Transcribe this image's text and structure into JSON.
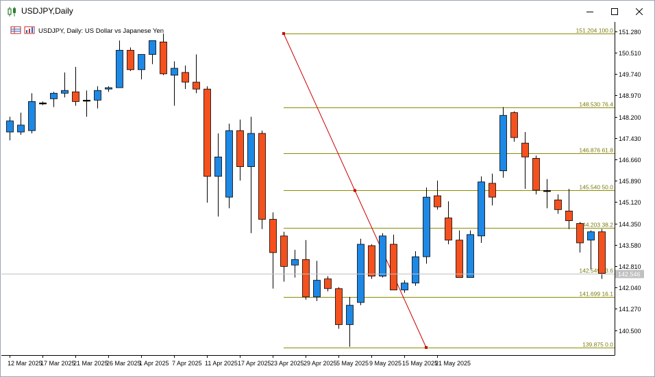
{
  "window": {
    "title": "USDJPY,Daily",
    "icons": [
      "candlestick-chart-icon",
      "minimize-icon",
      "maximize-icon",
      "close-icon"
    ]
  },
  "chart_header": {
    "text": "USDJPY, Daily:  US Dollar vs Japanese Yen",
    "icons": [
      "table-icon",
      "indicator-icon"
    ]
  },
  "chart_data": {
    "type": "candlestick",
    "symbol": "USDJPY",
    "timeframe": "Daily",
    "ylim": [
      139.6,
      151.55
    ],
    "y_ticks": [
      "151.280",
      "150.510",
      "149.740",
      "148.970",
      "148.200",
      "147.430",
      "146.660",
      "145.890",
      "145.120",
      "144.350",
      "143.580",
      "142.810",
      "142.040",
      "141.270",
      "140.500"
    ],
    "x_ticks": [
      "12 Mar 2025",
      "17 Mar 2025",
      "21 Mar 2025",
      "26 Mar 2025",
      "1 Apr 2025",
      "7 Apr 2025",
      "11 Apr 2025",
      "17 Apr 2025",
      "23 Apr 2025",
      "29 Apr 2025",
      "5 May 2025",
      "9 May 2025",
      "15 May 2025",
      "21 May 2025"
    ],
    "x_tick_index": [
      0,
      3,
      6,
      9,
      12,
      15,
      18,
      21,
      24,
      27,
      30,
      33,
      36,
      39
    ],
    "up_color": "#1e88e5",
    "down_color": "#f4511e",
    "current_price": "142.546",
    "candles": [
      {
        "o": 147.65,
        "h": 148.2,
        "l": 147.35,
        "c": 148.05
      },
      {
        "o": 147.65,
        "h": 148.35,
        "l": 147.55,
        "c": 147.9
      },
      {
        "o": 147.7,
        "h": 149.05,
        "l": 147.6,
        "c": 148.75
      },
      {
        "o": 148.7,
        "h": 148.75,
        "l": 148.62,
        "c": 148.7
      },
      {
        "o": 148.85,
        "h": 149.1,
        "l": 148.55,
        "c": 149.05
      },
      {
        "o": 149.05,
        "h": 149.8,
        "l": 148.9,
        "c": 149.15
      },
      {
        "o": 149.1,
        "h": 150.0,
        "l": 148.6,
        "c": 148.75
      },
      {
        "o": 148.8,
        "h": 149.15,
        "l": 148.2,
        "c": 148.8
      },
      {
        "o": 148.8,
        "h": 149.3,
        "l": 148.5,
        "c": 149.15
      },
      {
        "o": 149.2,
        "h": 149.3,
        "l": 149.1,
        "c": 149.25
      },
      {
        "o": 149.25,
        "h": 150.95,
        "l": 149.25,
        "c": 150.6
      },
      {
        "o": 150.6,
        "h": 150.7,
        "l": 149.85,
        "c": 149.9
      },
      {
        "o": 149.9,
        "h": 150.45,
        "l": 149.55,
        "c": 150.45
      },
      {
        "o": 150.45,
        "h": 150.95,
        "l": 150.1,
        "c": 150.95
      },
      {
        "o": 150.9,
        "h": 151.2,
        "l": 149.7,
        "c": 149.75
      },
      {
        "o": 149.7,
        "h": 150.2,
        "l": 148.6,
        "c": 149.95
      },
      {
        "o": 149.8,
        "h": 150.05,
        "l": 149.2,
        "c": 149.45
      },
      {
        "o": 149.45,
        "h": 150.45,
        "l": 149.05,
        "c": 149.2
      },
      {
        "o": 149.2,
        "h": 149.3,
        "l": 145.1,
        "c": 146.05
      },
      {
        "o": 146.05,
        "h": 147.6,
        "l": 144.6,
        "c": 146.75
      },
      {
        "o": 145.3,
        "h": 147.95,
        "l": 144.9,
        "c": 147.7
      },
      {
        "o": 147.7,
        "h": 148.1,
        "l": 145.9,
        "c": 146.4
      },
      {
        "o": 146.4,
        "h": 148.2,
        "l": 144.0,
        "c": 147.6
      },
      {
        "o": 147.6,
        "h": 147.7,
        "l": 144.15,
        "c": 144.5
      },
      {
        "o": 144.5,
        "h": 144.75,
        "l": 142.0,
        "c": 143.3
      },
      {
        "o": 143.9,
        "h": 144.05,
        "l": 142.25,
        "c": 142.8
      },
      {
        "o": 142.85,
        "h": 143.4,
        "l": 142.4,
        "c": 143.05
      },
      {
        "o": 143.05,
        "h": 143.75,
        "l": 141.6,
        "c": 141.7
      },
      {
        "o": 141.7,
        "h": 143.0,
        "l": 141.55,
        "c": 142.3
      },
      {
        "o": 142.35,
        "h": 142.45,
        "l": 141.9,
        "c": 142.0
      },
      {
        "o": 142.0,
        "h": 142.05,
        "l": 140.55,
        "c": 140.7
      },
      {
        "o": 140.7,
        "h": 141.7,
        "l": 139.9,
        "c": 141.4
      },
      {
        "o": 141.5,
        "h": 143.8,
        "l": 141.4,
        "c": 143.6
      },
      {
        "o": 143.55,
        "h": 143.6,
        "l": 142.35,
        "c": 142.45
      },
      {
        "o": 142.45,
        "h": 144.0,
        "l": 142.4,
        "c": 143.9
      },
      {
        "o": 143.6,
        "h": 143.95,
        "l": 141.95,
        "c": 141.95
      },
      {
        "o": 141.95,
        "h": 142.3,
        "l": 141.85,
        "c": 142.2
      },
      {
        "o": 142.2,
        "h": 143.35,
        "l": 142.1,
        "c": 143.15
      },
      {
        "o": 143.15,
        "h": 145.65,
        "l": 142.9,
        "c": 145.3
      },
      {
        "o": 145.35,
        "h": 145.9,
        "l": 144.85,
        "c": 144.95
      },
      {
        "o": 144.55,
        "h": 145.15,
        "l": 143.6,
        "c": 143.75
      },
      {
        "o": 143.75,
        "h": 144.1,
        "l": 142.4,
        "c": 142.4
      },
      {
        "o": 142.4,
        "h": 144.1,
        "l": 142.4,
        "c": 143.95
      },
      {
        "o": 143.9,
        "h": 146.05,
        "l": 143.65,
        "c": 145.85
      },
      {
        "o": 145.8,
        "h": 146.15,
        "l": 145.0,
        "c": 145.3
      },
      {
        "o": 146.25,
        "h": 148.55,
        "l": 146.0,
        "c": 148.25
      },
      {
        "o": 148.35,
        "h": 148.4,
        "l": 147.3,
        "c": 147.45
      },
      {
        "o": 147.25,
        "h": 147.65,
        "l": 145.6,
        "c": 146.75
      },
      {
        "o": 146.7,
        "h": 146.8,
        "l": 145.4,
        "c": 145.55
      },
      {
        "o": 145.54,
        "h": 145.95,
        "l": 144.9,
        "c": 145.54
      },
      {
        "o": 145.2,
        "h": 145.4,
        "l": 144.7,
        "c": 144.85
      },
      {
        "o": 144.8,
        "h": 145.6,
        "l": 144.15,
        "c": 144.45
      },
      {
        "o": 144.35,
        "h": 144.4,
        "l": 143.3,
        "c": 143.65
      },
      {
        "o": 143.75,
        "h": 144.1,
        "l": 142.7,
        "c": 144.05
      },
      {
        "o": 144.05,
        "h": 144.15,
        "l": 142.35,
        "c": 142.55
      }
    ],
    "fibonacci": {
      "start_index": 25,
      "levels": [
        {
          "price": 151.204,
          "label": "151.204 100.0"
        },
        {
          "price": 148.53,
          "label": "148.530 76.4"
        },
        {
          "price": 146.876,
          "label": "146.876 61.8"
        },
        {
          "price": 145.54,
          "label": "145.540 50.0"
        },
        {
          "price": 144.203,
          "label": "144.203 38.2"
        },
        {
          "price": 142.549,
          "label": "142.549 23.6"
        },
        {
          "price": 141.699,
          "label": "141.699 16.1"
        },
        {
          "price": 139.875,
          "label": "139.875 0.0"
        }
      ],
      "color": "#8b8b00"
    },
    "trendline": {
      "from": {
        "index": 25,
        "price": 151.204
      },
      "to": {
        "index": 38,
        "price": 139.875
      },
      "color": "#cc0000"
    }
  }
}
